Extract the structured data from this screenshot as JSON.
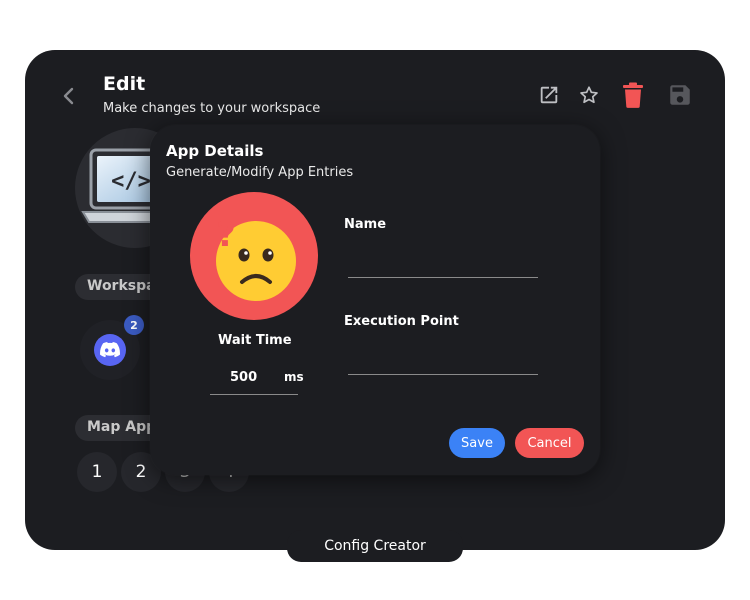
{
  "header": {
    "title": "Edit",
    "subtitle": "Make changes to your workspace"
  },
  "colors": {
    "window_bg": "#1c1d21",
    "accent_blue": "#3b82f6",
    "accent_red": "#f25555",
    "emoji_face": "#ffcc33",
    "discord": "#5865f2"
  },
  "icons": {
    "back": "chevron-left-icon",
    "open": "external-link-icon",
    "star": "star-outline-icon",
    "trash": "trash-icon",
    "save": "floppy-disk-icon"
  },
  "workspace": {
    "section_label": "Workspa",
    "apps": [
      {
        "name": "discord",
        "badge": "2"
      }
    ]
  },
  "map_apps": {
    "section_label": "Map App",
    "numbers": [
      "1",
      "2",
      "3",
      "4"
    ]
  },
  "modal": {
    "title": "App Details",
    "subtitle": "Generate/Modify App Entries",
    "wait_time": {
      "label": "Wait Time",
      "value": "500",
      "unit": "ms"
    },
    "name_field": {
      "label": "Name",
      "value": ""
    },
    "execution_point_field": {
      "label": "Execution Point",
      "value": ""
    },
    "save_label": "Save",
    "cancel_label": "Cancel"
  },
  "footer": {
    "label": "Config Creator"
  }
}
